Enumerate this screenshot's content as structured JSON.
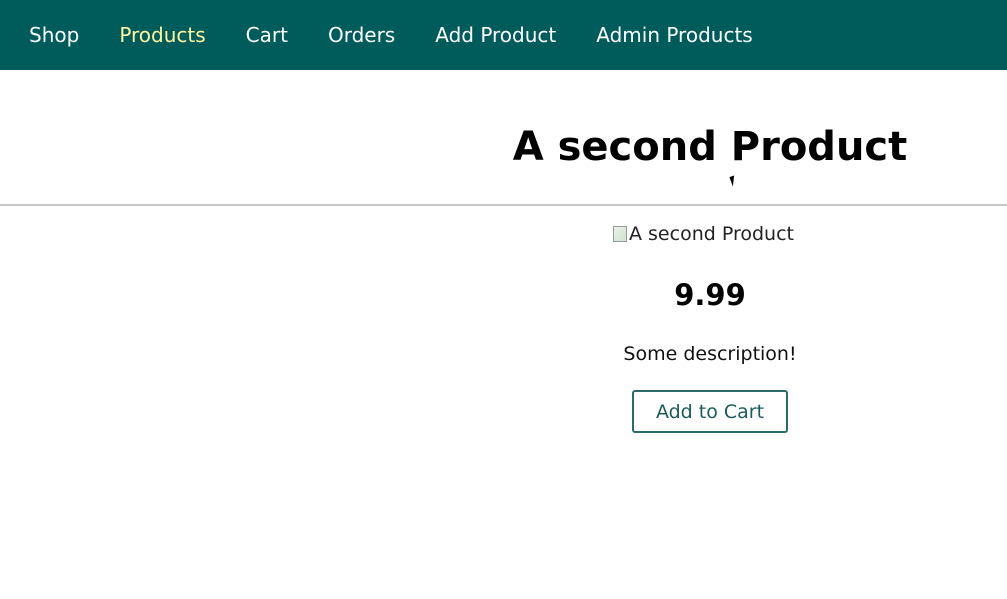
{
  "nav": {
    "items": [
      {
        "label": "Shop",
        "active": false
      },
      {
        "label": "Products",
        "active": true
      },
      {
        "label": "Cart",
        "active": false
      },
      {
        "label": "Orders",
        "active": false
      },
      {
        "label": "Add Product",
        "active": false
      },
      {
        "label": "Admin Products",
        "active": false
      }
    ]
  },
  "product": {
    "title": "A second Product",
    "image_alt": "A second Product",
    "price": "9.99",
    "description": "Some description!",
    "add_to_cart_label": "Add to Cart"
  },
  "colors": {
    "header_bg": "#005b5b",
    "nav_text": "#ffffff",
    "nav_active": "#fff59d",
    "button_border": "#2d6b6b"
  }
}
